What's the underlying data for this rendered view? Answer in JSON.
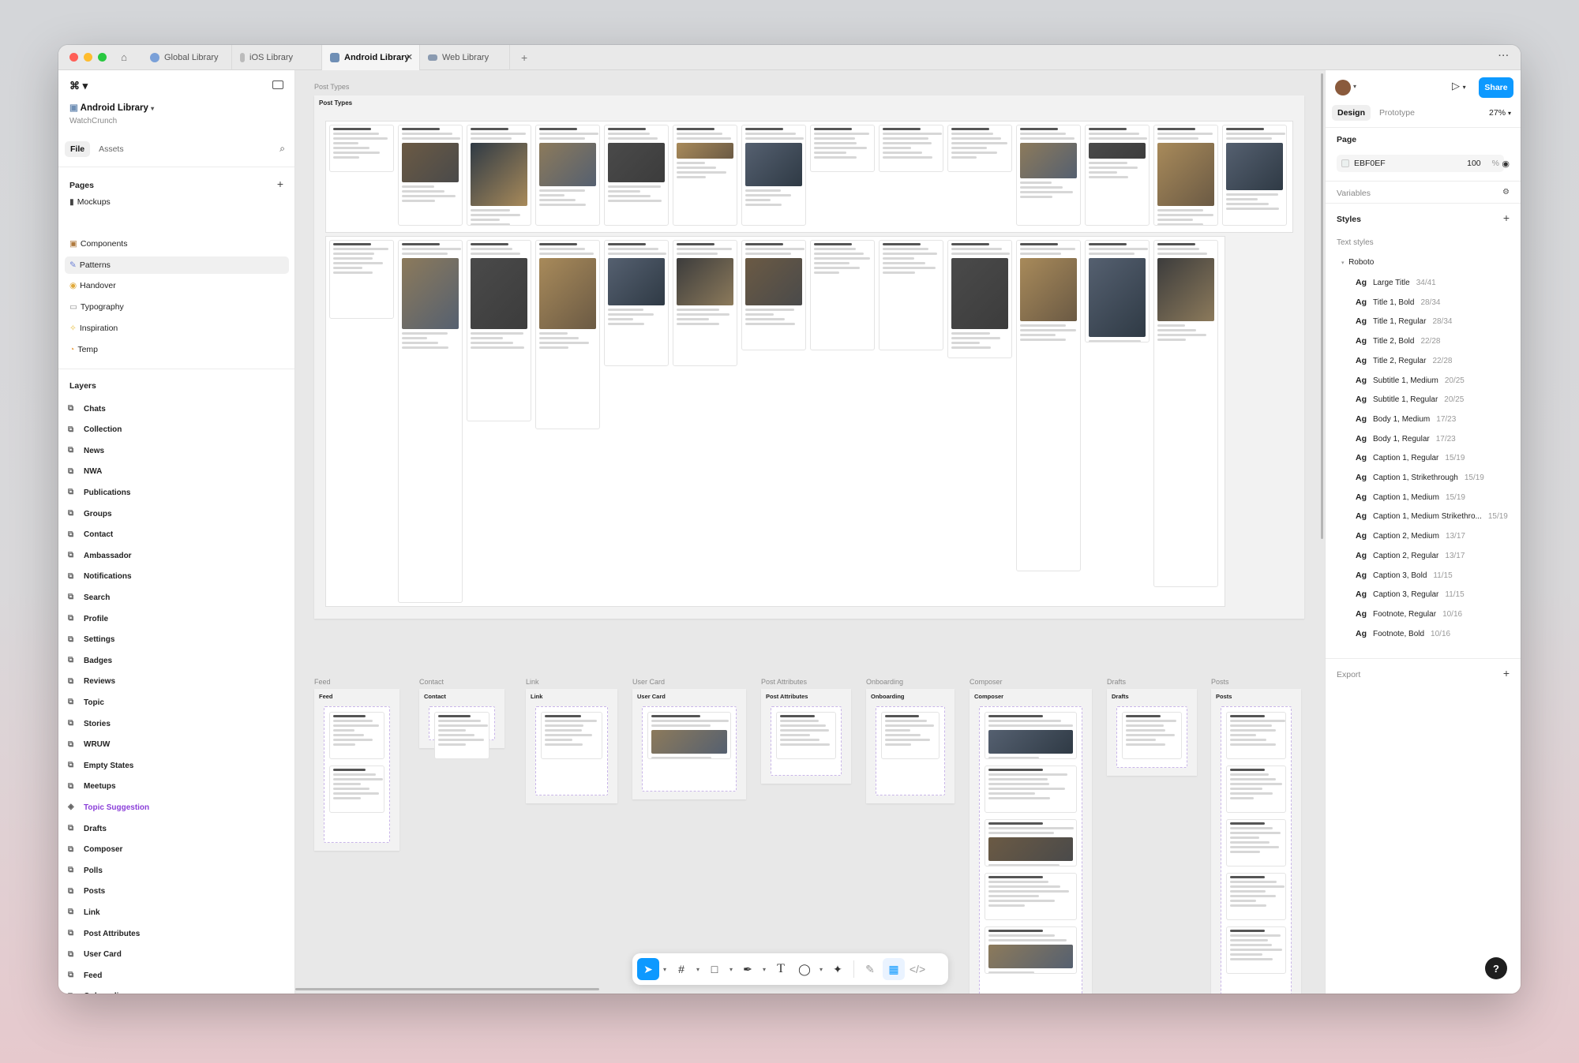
{
  "tabs": [
    {
      "label": "Global Library",
      "icon": "globe-icon",
      "active": false
    },
    {
      "label": "iOS Library",
      "icon": "file-icon",
      "active": false
    },
    {
      "label": "Android Library",
      "icon": "android-icon",
      "active": true
    },
    {
      "label": "Web Library",
      "icon": "browser-icon",
      "active": false
    }
  ],
  "file": {
    "name": "Android Library",
    "team": "WatchCrunch"
  },
  "left_tabs": {
    "file": "File",
    "assets": "Assets"
  },
  "pages": {
    "title": "Pages",
    "items": [
      "Mockups",
      "Components",
      "Patterns",
      "Handover",
      "Typography",
      "Inspiration",
      "Temp"
    ]
  },
  "layers": {
    "title": "Layers",
    "items": [
      "Chats",
      "Collection",
      "News",
      "NWA",
      "Publications",
      "Groups",
      "Contact",
      "Ambassador",
      "Notifications",
      "Search",
      "Profile",
      "Settings",
      "Badges",
      "Reviews",
      "Topic",
      "Stories",
      "WRUW",
      "Empty States",
      "Meetups",
      "Topic Suggestion",
      "Drafts",
      "Composer",
      "Polls",
      "Posts",
      "Link",
      "Post Attributes",
      "User Card",
      "Feed",
      "Onboarding"
    ]
  },
  "canvas": {
    "top_section_label": "Post Types",
    "inner_frame_title": "Post Types",
    "bottom_frames": [
      {
        "label": "Feed",
        "title": "Feed"
      },
      {
        "label": "Contact",
        "title": "Contact"
      },
      {
        "label": "Link",
        "title": "Link"
      },
      {
        "label": "User Card",
        "title": "User Card"
      },
      {
        "label": "Post Attributes",
        "title": "Post Attributes"
      },
      {
        "label": "Onboarding",
        "title": "Onboarding"
      },
      {
        "label": "Composer",
        "title": "Composer"
      },
      {
        "label": "Drafts",
        "title": "Drafts"
      },
      {
        "label": "Posts",
        "title": "Posts"
      }
    ]
  },
  "right": {
    "share": "Share",
    "tabs": {
      "design": "Design",
      "prototype": "Prototype"
    },
    "zoom": "27%",
    "page_title": "Page",
    "page_color": "EBF0EF",
    "page_opacity": "100",
    "page_pct": "%",
    "variables": "Variables",
    "styles": "Styles",
    "text_styles": "Text styles",
    "font_group": "Roboto",
    "style_items": [
      {
        "name": "Large Title",
        "size": "34/41"
      },
      {
        "name": "Title 1, Bold",
        "size": "28/34"
      },
      {
        "name": "Title 1, Regular",
        "size": "28/34"
      },
      {
        "name": "Title 2, Bold",
        "size": "22/28"
      },
      {
        "name": "Title 2, Regular",
        "size": "22/28"
      },
      {
        "name": "Subtitle 1, Medium",
        "size": "20/25"
      },
      {
        "name": "Subtitle 1, Regular",
        "size": "20/25"
      },
      {
        "name": "Body 1, Medium",
        "size": "17/23"
      },
      {
        "name": "Body 1, Regular",
        "size": "17/23"
      },
      {
        "name": "Caption 1, Regular",
        "size": "15/19"
      },
      {
        "name": "Caption 1, Strikethrough",
        "size": "15/19"
      },
      {
        "name": "Caption 1, Medium",
        "size": "15/19"
      },
      {
        "name": "Caption 1, Medium Strikethro...",
        "size": "15/19"
      },
      {
        "name": "Caption 2, Medium",
        "size": "13/17"
      },
      {
        "name": "Caption 2, Regular",
        "size": "13/17"
      },
      {
        "name": "Caption 3, Bold",
        "size": "11/15"
      },
      {
        "name": "Caption 3, Regular",
        "size": "11/15"
      },
      {
        "name": "Footnote, Regular",
        "size": "10/16"
      },
      {
        "name": "Footnote, Bold",
        "size": "10/16"
      }
    ],
    "export": "Export",
    "ag": "Ag"
  },
  "help": "?",
  "colors": {
    "accent": "#0d99ff",
    "purple": "#8b3fd9",
    "green": "#19b57a"
  }
}
